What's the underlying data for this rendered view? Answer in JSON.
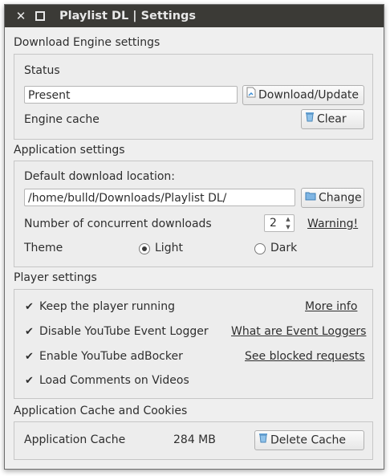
{
  "window": {
    "title": "Playlist DL | Settings"
  },
  "download_engine": {
    "heading": "Download Engine settings",
    "status_label": "Status",
    "status_value": "Present",
    "update_button": "Download/Update",
    "cache_label": "Engine cache",
    "clear_button": "Clear"
  },
  "application": {
    "heading": "Application settings",
    "location_label": "Default download location:",
    "location_value": "/home/bulld/Downloads/Playlist DL/",
    "change_button": "Change",
    "concurrent_label": "Number of concurrent downloads",
    "concurrent_value": "2",
    "warning_link": "Warning!",
    "theme_label": "Theme",
    "theme_options": [
      {
        "label": "Light",
        "selected": true
      },
      {
        "label": "Dark",
        "selected": false
      }
    ]
  },
  "player": {
    "heading": "Player settings",
    "options": [
      {
        "label": "Keep the player running",
        "checked": true,
        "link": "More info"
      },
      {
        "label": "Disable YouTube Event Logger",
        "checked": true,
        "link": "What are Event Loggers"
      },
      {
        "label": "Enable YouTube adBocker",
        "checked": true,
        "link": "See blocked requests"
      },
      {
        "label": "Load Comments on Videos",
        "checked": true,
        "link": ""
      }
    ]
  },
  "cache": {
    "heading": "Application Cache and Cookies",
    "label": "Application Cache",
    "size": "284 MB",
    "delete_button": "Delete Cache"
  },
  "icons": {
    "close": "close-icon",
    "maximize": "maximize-icon",
    "update": "document-icon",
    "clear": "trash-icon",
    "change": "folder-icon",
    "delete": "trash-icon"
  }
}
